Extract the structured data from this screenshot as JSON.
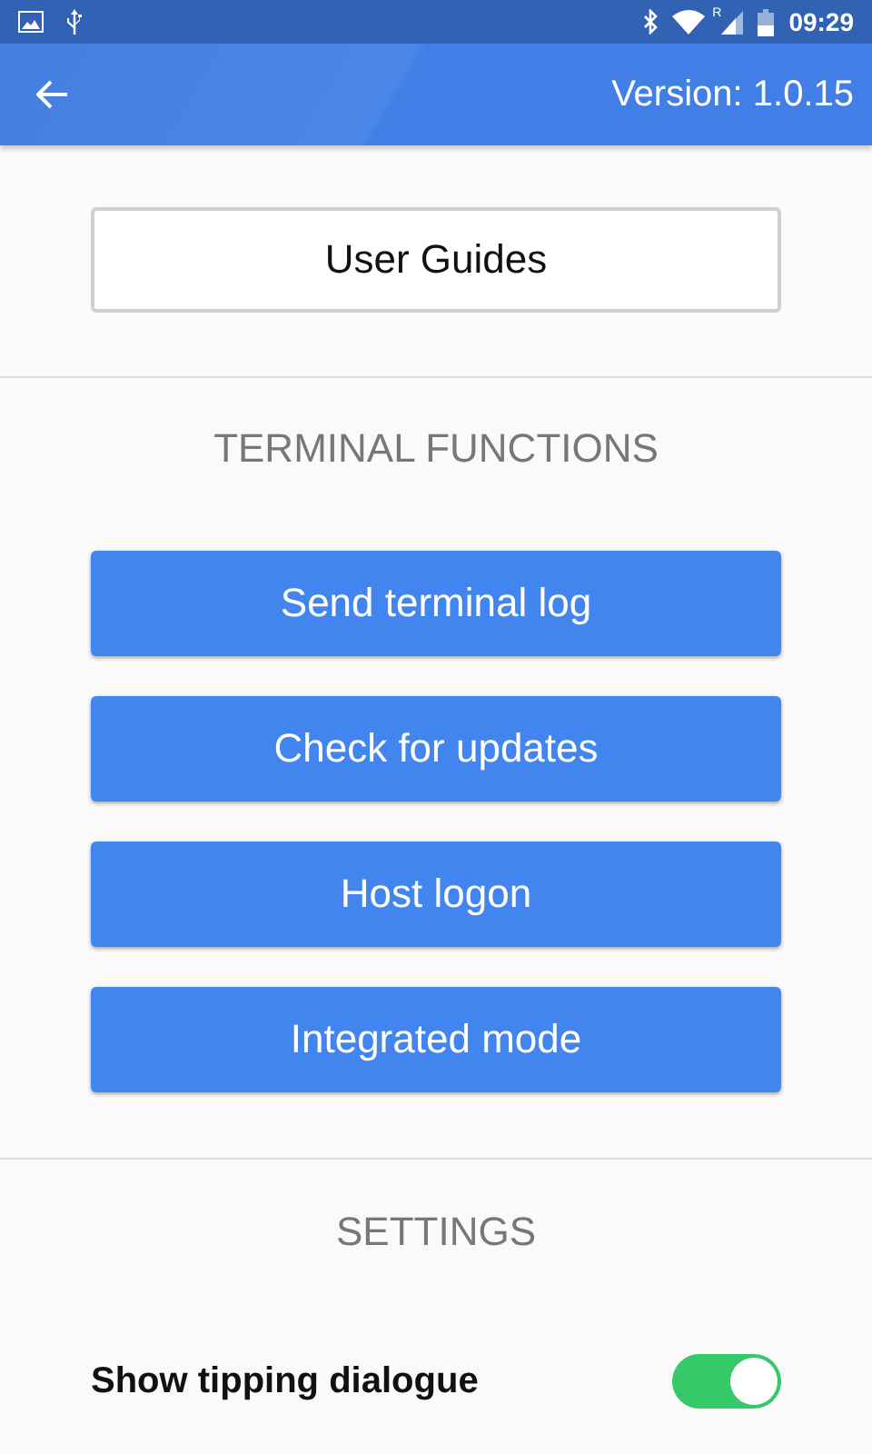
{
  "status_bar": {
    "roaming_mark": "R",
    "time": "09:29"
  },
  "app_bar": {
    "version": "Version: 1.0.15"
  },
  "user_guides_button": "User Guides",
  "terminal_functions": {
    "heading": "TERMINAL FUNCTIONS",
    "buttons": [
      "Send terminal log",
      "Check for updates",
      "Host logon",
      "Integrated mode"
    ]
  },
  "settings": {
    "heading": "SETTINGS",
    "items": [
      {
        "kind": "toggle",
        "label": "Show tipping dialogue",
        "on": true
      }
    ]
  }
}
